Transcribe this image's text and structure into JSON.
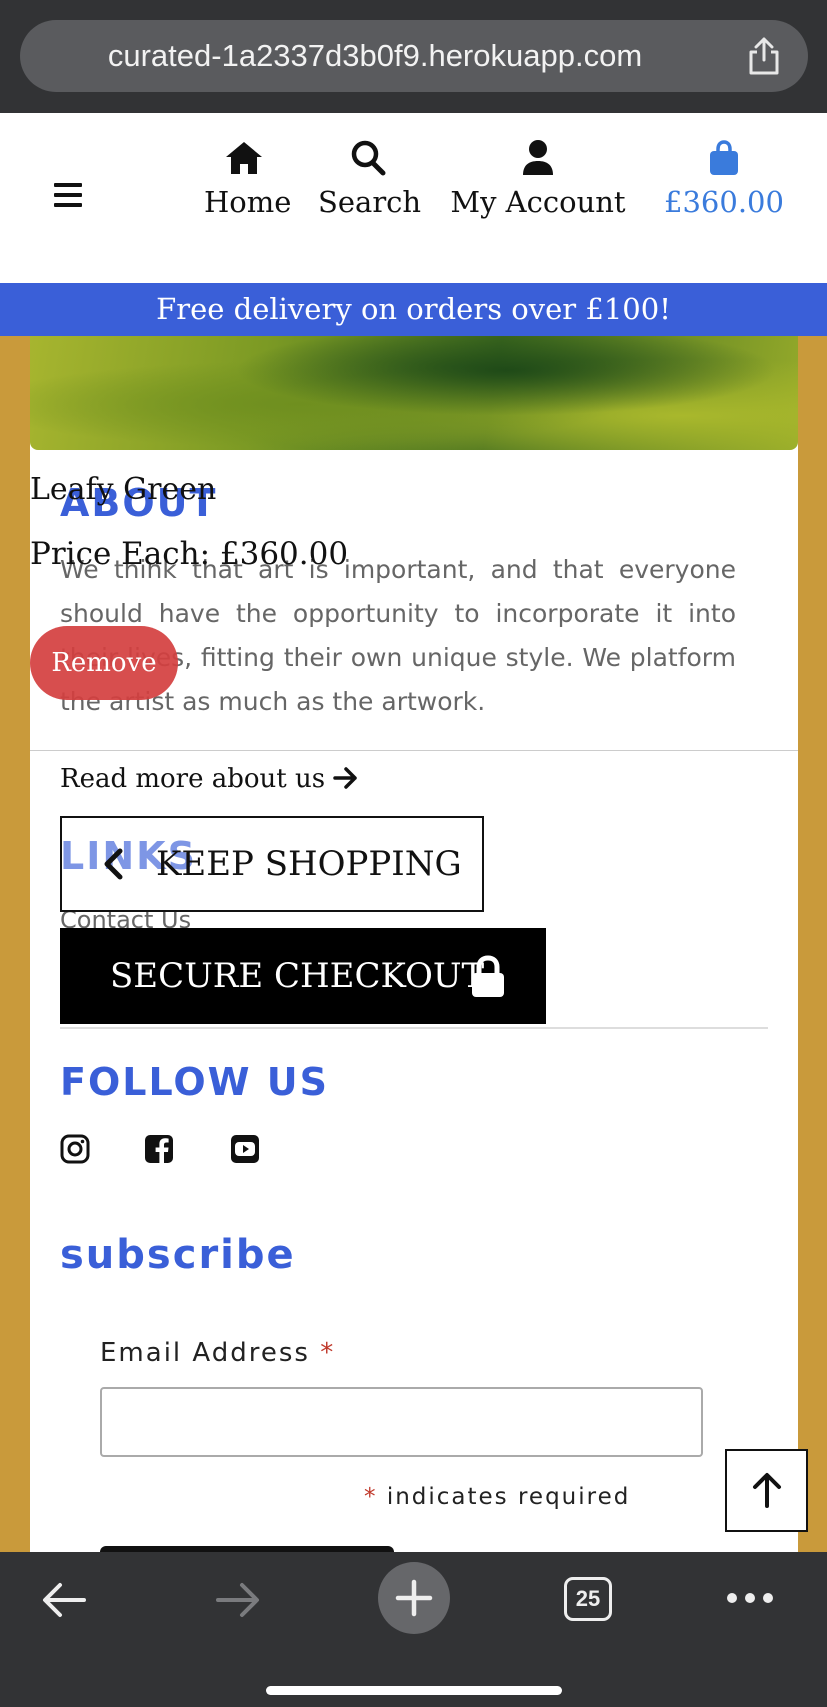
{
  "browser": {
    "url": "curated-1a2337d3b0f9.herokuapp.com",
    "tab_count": "25"
  },
  "nav": {
    "home": "Home",
    "search": "Search",
    "account": "My Account",
    "bag_total": "£360.00"
  },
  "banner": {
    "text": "Free delivery on orders over £100!"
  },
  "product": {
    "title": "Leafy Green",
    "price": "Price Each: £360.00",
    "remove_label": "Remove"
  },
  "about": {
    "title": "ABOUT",
    "text": "We think that art is important, and that everyone should have the opportunity to incorporate it into their lives, fitting their own unique style. We platform the artist as much as the artwork.",
    "read_more": "Read more about us"
  },
  "links": {
    "title": "LINKS",
    "contact": "Contact Us"
  },
  "actions": {
    "keep_shopping": "KEEP SHOPPING",
    "checkout": "SECURE CHECKOUT"
  },
  "follow": {
    "title": "FOLLOW US"
  },
  "subscribe": {
    "title": "subscribe",
    "email_label": "Email Address",
    "required_star": "*",
    "required_note": "indicates required"
  },
  "colors": {
    "accent": "#3a5fd8",
    "bag": "#3a7bdc",
    "remove": "#d43f3f",
    "page_bg": "#c99a3b"
  },
  "icons": [
    "share-icon",
    "menu-icon",
    "home-icon",
    "search-icon",
    "user-icon",
    "bag-icon",
    "arrow-right-icon",
    "chevron-left-icon",
    "lock-icon",
    "instagram-icon",
    "facebook-icon",
    "youtube-icon",
    "arrow-up-icon",
    "back-icon",
    "forward-icon",
    "plus-icon",
    "more-icon"
  ]
}
